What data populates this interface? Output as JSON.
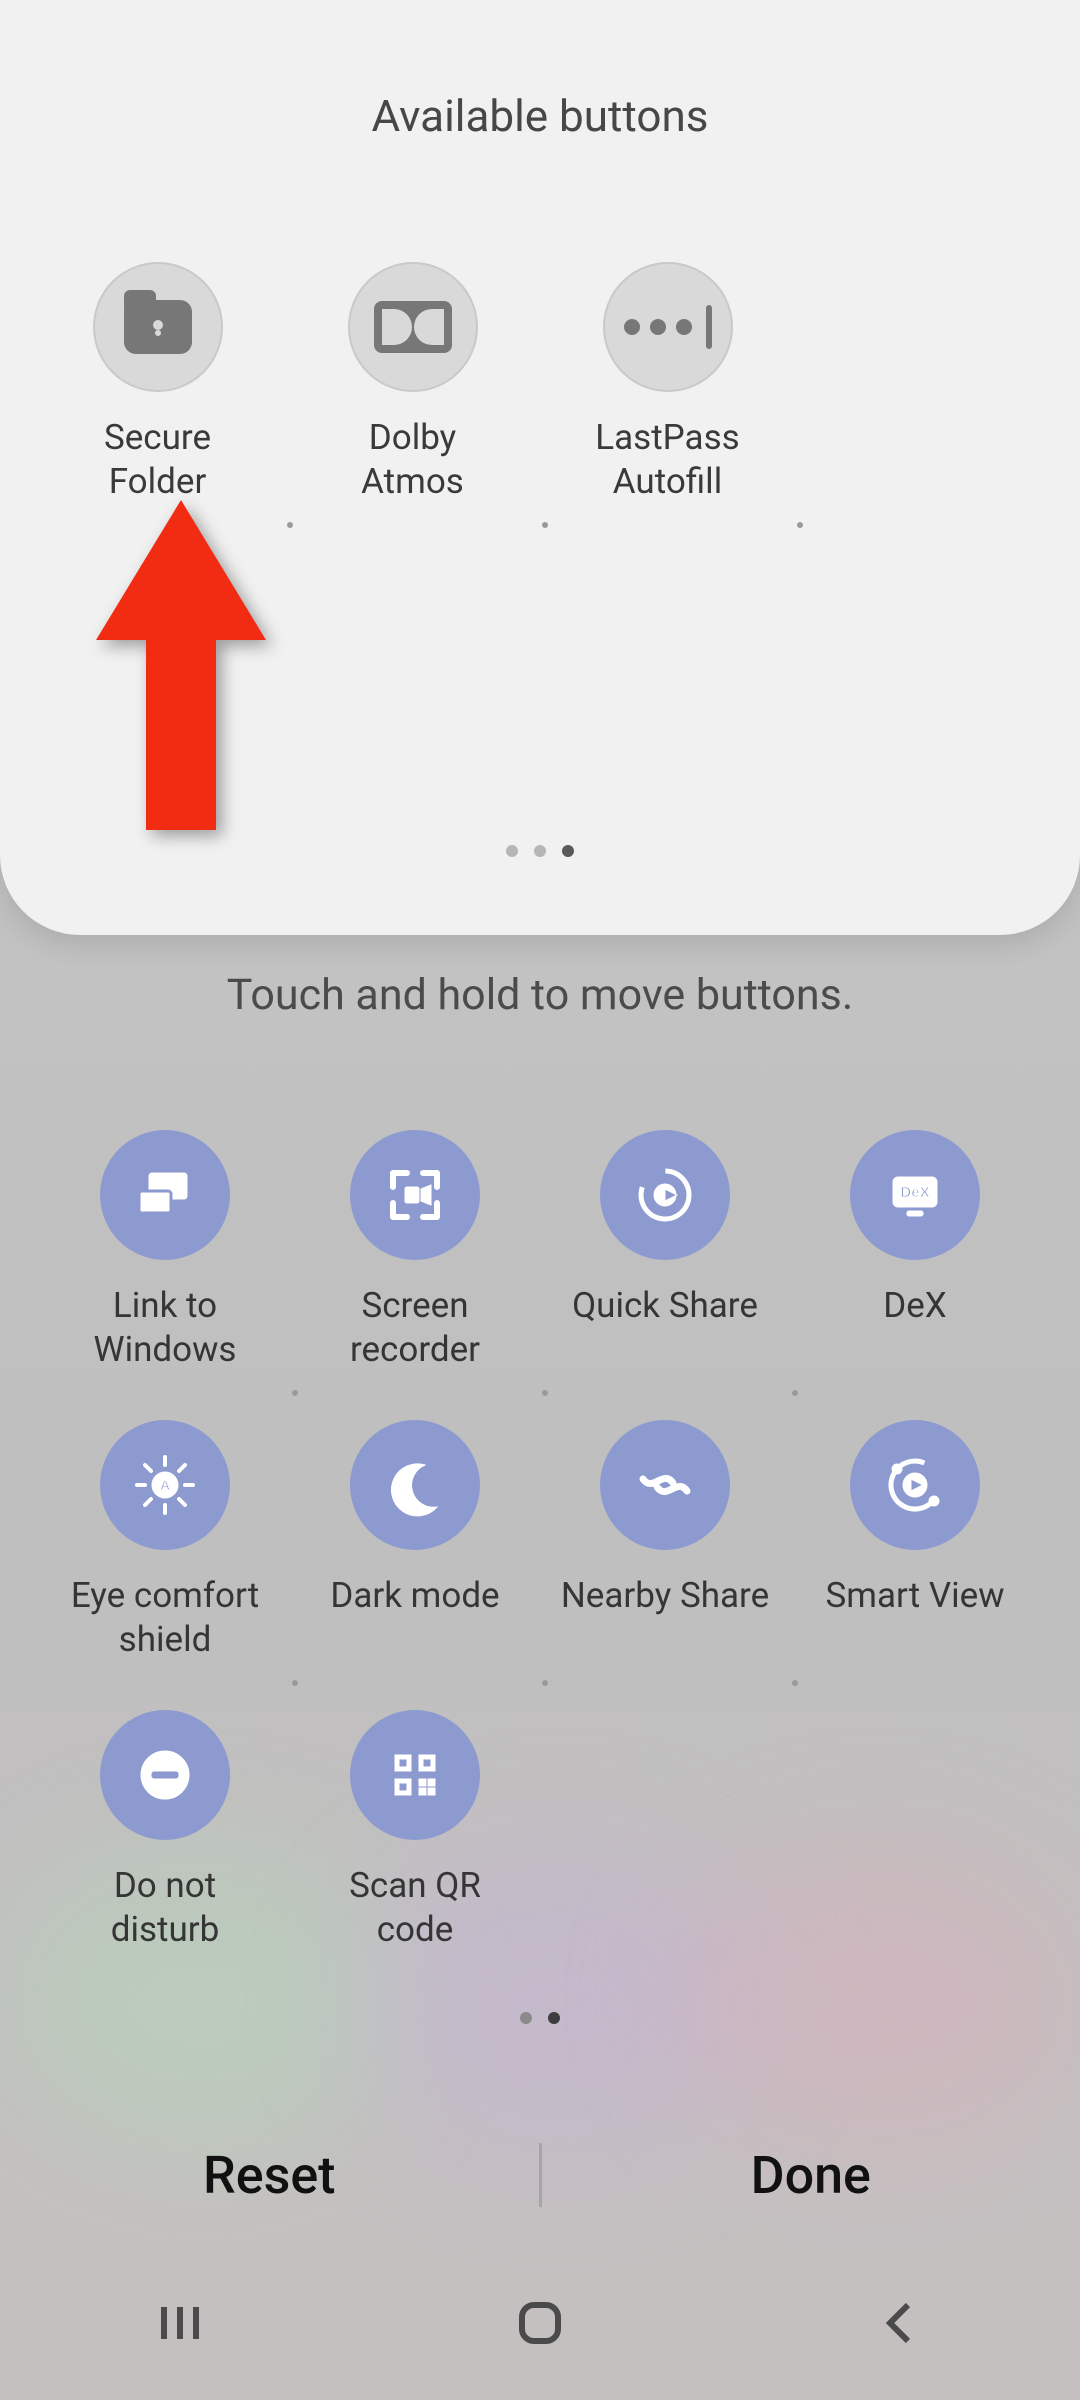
{
  "available": {
    "title": "Available buttons",
    "items": [
      {
        "label": "Secure\nFolder",
        "icon": "folder-lock-icon"
      },
      {
        "label": "Dolby\nAtmos",
        "icon": "dolby-icon"
      },
      {
        "label": "LastPass\nAutofill",
        "icon": "lastpass-icon"
      }
    ],
    "page_dots": {
      "count": 3,
      "active_index": 2
    }
  },
  "instruction": "Touch and hold to move buttons.",
  "active": {
    "items": [
      {
        "label": "Link to\nWindows",
        "icon": "link-windows-icon"
      },
      {
        "label": "Screen\nrecorder",
        "icon": "screen-recorder-icon"
      },
      {
        "label": "Quick Share",
        "icon": "quick-share-icon"
      },
      {
        "label": "DeX",
        "icon": "dex-icon"
      },
      {
        "label": "Eye comfort\nshield",
        "icon": "eye-comfort-icon"
      },
      {
        "label": "Dark mode",
        "icon": "dark-mode-icon"
      },
      {
        "label": "Nearby Share",
        "icon": "nearby-share-icon"
      },
      {
        "label": "Smart View",
        "icon": "smart-view-icon"
      },
      {
        "label": "Do not\ndisturb",
        "icon": "dnd-icon"
      },
      {
        "label": "Scan QR\ncode",
        "icon": "qr-icon"
      }
    ],
    "page_dots": {
      "count": 2,
      "active_index": 1
    }
  },
  "footer": {
    "reset": "Reset",
    "done": "Done"
  },
  "annotation": {
    "arrow_points_to": "Secure Folder"
  }
}
